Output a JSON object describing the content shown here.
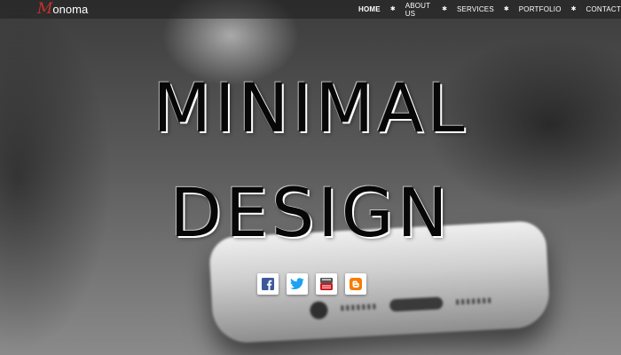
{
  "brand": {
    "logo_initial": "M",
    "logo_rest": "onoma"
  },
  "nav": {
    "items": [
      {
        "label": "HOME",
        "active": true
      },
      {
        "label": "ABOUT US",
        "active": false
      },
      {
        "label": "SERVICES",
        "active": false
      },
      {
        "label": "PORTFOLIO",
        "active": false
      },
      {
        "label": "CONTACT",
        "active": false
      }
    ],
    "separator": "✱"
  },
  "hero": {
    "line1": "MINIMAL",
    "line2": "DESIGN"
  },
  "social": [
    {
      "icon": "facebook-icon",
      "color": "#3b5998"
    },
    {
      "icon": "twitter-icon",
      "color": "#1da1f2"
    },
    {
      "icon": "youtube-icon",
      "color": "#cc181e"
    },
    {
      "icon": "blogger-icon",
      "color": "#f57d00"
    }
  ],
  "colors": {
    "logo_accent": "#c9302c",
    "nav_text": "#ffffff",
    "headline": "#070707"
  }
}
